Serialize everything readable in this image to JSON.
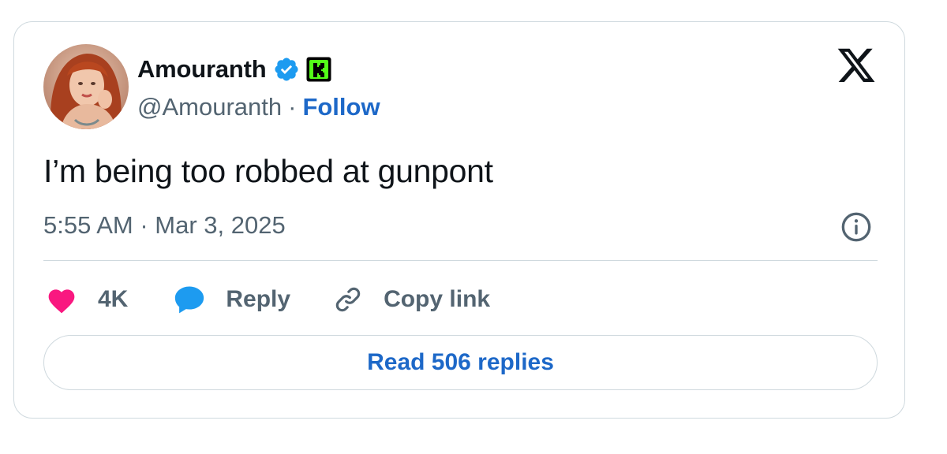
{
  "author": {
    "display_name": "Amouranth",
    "handle": "@Amouranth",
    "separator": "·",
    "follow_label": "Follow",
    "badges": [
      "verified-icon",
      "kick-badge-icon"
    ]
  },
  "tweet": {
    "text": "I’m being too robbed at gunpont",
    "timestamp": "5:55 AM · Mar 3, 2025"
  },
  "actions": {
    "like_count": "4K",
    "reply_label": "Reply",
    "copy_link_label": "Copy link"
  },
  "read_replies_label": "Read 506 replies",
  "icons": {
    "brand_logo": "x-logo-icon",
    "info": "info-icon",
    "like": "heart-icon",
    "reply": "speech-bubble-icon",
    "copy": "link-icon"
  },
  "colors": {
    "text_primary": "#0f1419",
    "text_secondary": "#536471",
    "link_blue": "#1d68c8",
    "verified_blue": "#1d9bf0",
    "heart_pink": "#f91880",
    "kick_green": "#53fc18",
    "border": "#cfd9de"
  }
}
